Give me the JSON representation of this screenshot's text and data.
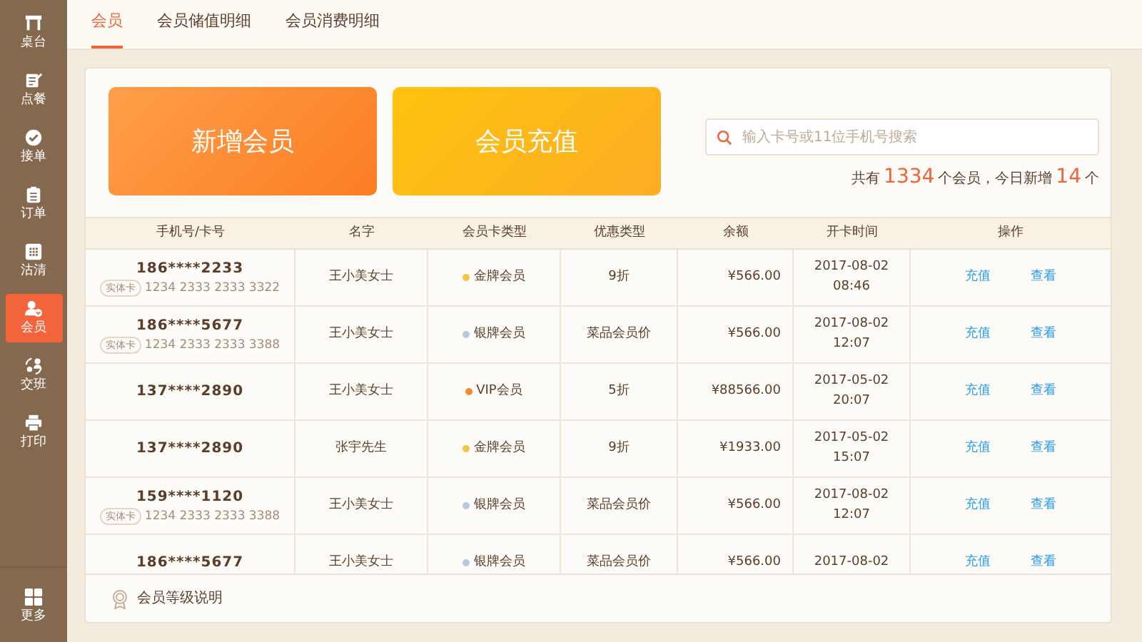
{
  "sidebar": {
    "items": [
      {
        "label": "桌台",
        "selected": false
      },
      {
        "label": "点餐",
        "selected": false
      },
      {
        "label": "接单",
        "selected": false
      },
      {
        "label": "订单",
        "selected": false
      },
      {
        "label": "沽清",
        "selected": false
      },
      {
        "label": "会员",
        "selected": true
      },
      {
        "label": "交班",
        "selected": false
      },
      {
        "label": "打印",
        "selected": false
      }
    ],
    "more": {
      "label": "更多"
    }
  },
  "tabs": [
    {
      "label": "会员",
      "selected": true
    },
    {
      "label": "会员储值明细",
      "selected": false
    },
    {
      "label": "会员消费明细",
      "selected": false
    }
  ],
  "actions": [
    {
      "label": "新增会员",
      "kind": "add"
    },
    {
      "label": "会员充值",
      "kind": "recharge"
    }
  ],
  "search": {
    "placeholder": "输入卡号或11位手机号搜索"
  },
  "summary": {
    "text_1": "共有",
    "total": "1334",
    "text_2": "个会员，今日新增",
    "new_today": "14",
    "text_3": "个"
  },
  "table": {
    "columns": [
      "手机号/卡号",
      "名字",
      "会员卡类型",
      "优惠类型",
      "余额",
      "开卡时间",
      "操作"
    ],
    "rows": [
      {
        "phone": "186****2233",
        "card_tag": "实体卡",
        "card_number": "1234 2333 2333 3322",
        "name": "王小美女士",
        "card_type": "金牌会员",
        "color": "#f7c443",
        "discount": "9折",
        "balance": "¥566.00",
        "date": "2017-08-02",
        "time": "08:46",
        "actions": [
          "充值",
          "查看"
        ]
      },
      {
        "phone": "186****5677",
        "card_tag": "实体卡",
        "card_number": "1234 2333 2333 3388",
        "name": "王小美女士",
        "card_type": "银牌会员",
        "color": "#b5c9dc",
        "discount": "菜品会员价",
        "balance": "¥566.00",
        "date": "2017-08-02",
        "time": "12:07",
        "actions": [
          "充值",
          "查看"
        ]
      },
      {
        "phone": "137****2890",
        "name": "王小美女士",
        "card_type": "VIP会员",
        "color": "#f58a2c",
        "discount": "5折",
        "balance": "¥88566.00",
        "date": "2017-05-02",
        "time": "20:07",
        "actions": [
          "充值",
          "查看"
        ]
      },
      {
        "phone": "137****2890",
        "name": "张宇先生",
        "card_type": "金牌会员",
        "color": "#f7c443",
        "discount": "9折",
        "balance": "¥1933.00",
        "date": "2017-05-02",
        "time": "15:07",
        "actions": [
          "充值",
          "查看"
        ]
      },
      {
        "phone": "159****1120",
        "card_tag": "实体卡",
        "card_number": "1234 2333 2333 3388",
        "name": "王小美女士",
        "card_type": "银牌会员",
        "color": "#b5c9dc",
        "discount": "菜品会员价",
        "balance": "¥566.00",
        "date": "2017-08-02",
        "time": "12:07",
        "actions": [
          "充值",
          "查看"
        ]
      },
      {
        "phone": "186****5677",
        "name": "王小美女士",
        "card_type": "银牌会员",
        "color": "#b5c9dc",
        "discount": "菜品会员价",
        "balance": "¥566.00",
        "date": "2017-08-02",
        "actions": [
          "充值",
          "查看"
        ]
      }
    ]
  },
  "footer": {
    "label": "会员等级说明"
  }
}
